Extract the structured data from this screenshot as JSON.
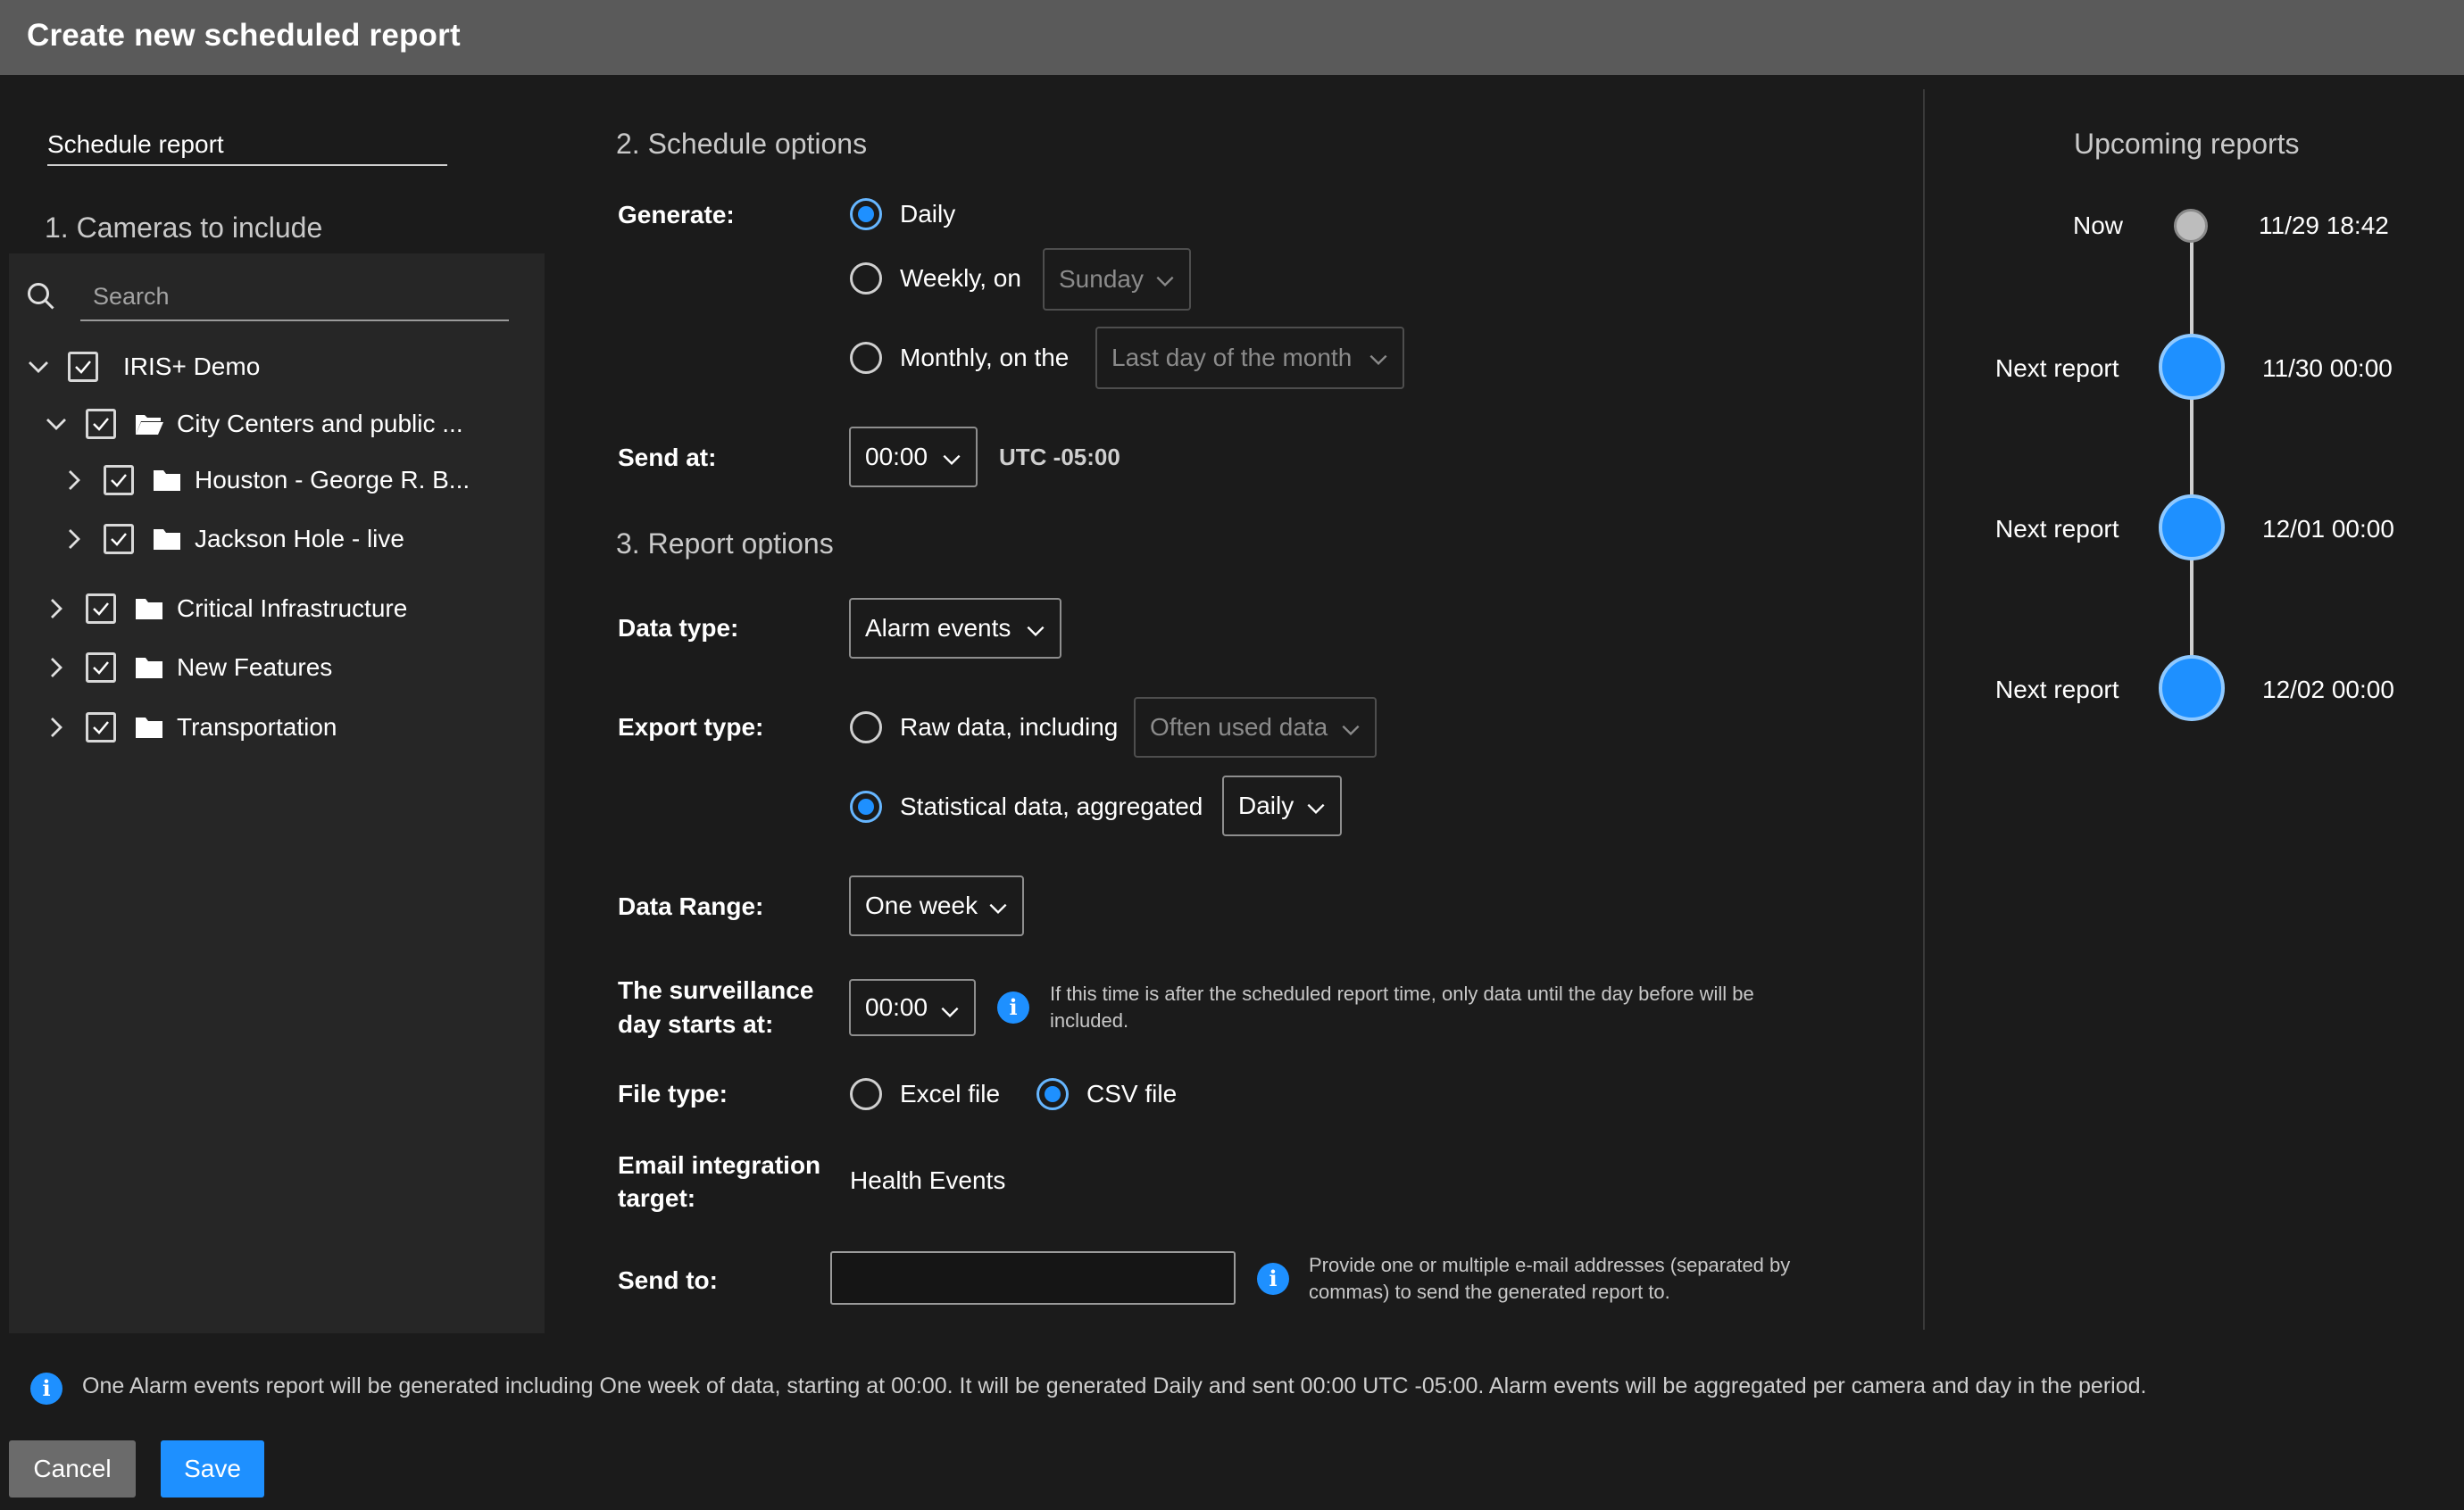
{
  "dialog": {
    "title": "Create new scheduled report"
  },
  "left": {
    "tab_label": "Schedule report",
    "section_title": "1. Cameras to include",
    "search": {
      "placeholder": "Search",
      "value": ""
    },
    "tree": [
      {
        "label": "IRIS+ Demo",
        "expanded": true,
        "checked": true,
        "icon": "none"
      },
      {
        "label": "City Centers and public ...",
        "expanded": true,
        "checked": true,
        "icon": "folder-open-icon"
      },
      {
        "label": "Houston - George R. B...",
        "expanded": false,
        "checked": true,
        "icon": "folder-icon"
      },
      {
        "label": "Jackson Hole - live",
        "expanded": false,
        "checked": true,
        "icon": "folder-icon"
      },
      {
        "label": "Critical Infrastructure",
        "expanded": false,
        "checked": true,
        "icon": "folder-icon"
      },
      {
        "label": "New Features",
        "expanded": false,
        "checked": true,
        "icon": "folder-icon"
      },
      {
        "label": "Transportation",
        "expanded": false,
        "checked": true,
        "icon": "folder-icon"
      }
    ]
  },
  "schedule": {
    "section_title": "2. Schedule options",
    "generate_label": "Generate:",
    "daily_label": "Daily",
    "weekly_label": "Weekly, on",
    "weekly_day": "Sunday",
    "monthly_label": "Monthly, on the",
    "monthly_value": "Last day of the month",
    "send_at_label": "Send at:",
    "send_at_value": "00:00",
    "timezone": "UTC -05:00"
  },
  "report": {
    "section_title": "3. Report options",
    "data_type_label": "Data type:",
    "data_type_value": "Alarm events",
    "export_type_label": "Export type:",
    "raw_label": "Raw data, including",
    "raw_value": "Often used data",
    "stat_label": "Statistical data, aggregated",
    "stat_value": "Daily",
    "data_range_label": "Data Range:",
    "data_range_value": "One week",
    "day_start_label_1": "The surveillance",
    "day_start_label_2": "day starts at:",
    "day_start_value": "00:00",
    "day_start_note_1": "If this time is after the scheduled report time, only data until the day before will be",
    "day_start_note_2": "included.",
    "file_type_label": "File type:",
    "excel_label": "Excel file",
    "csv_label": "CSV file",
    "email_label_1": "Email integration",
    "email_label_2": "target:",
    "email_value": "Health Events",
    "send_to_label": "Send to:",
    "send_to_value": "",
    "send_to_note_1": "Provide one or multiple e-mail addresses (separated by",
    "send_to_note_2": "commas) to send the generated report to."
  },
  "upcoming": {
    "title": "Upcoming reports",
    "now_label": "Now",
    "now_time": "11/29 18:42",
    "items": [
      {
        "label": "Next report",
        "time": "11/30 00:00"
      },
      {
        "label": "Next report",
        "time": "12/01 00:00"
      },
      {
        "label": "Next report",
        "time": "12/02 00:00"
      }
    ]
  },
  "footer": {
    "summary": "One Alarm events report will be generated including One week of data, starting at 00:00. It will be generated Daily and sent 00:00 UTC -05:00. Alarm events will be aggregated per camera and day in the period.",
    "cancel_label": "Cancel",
    "save_label": "Save"
  },
  "colors": {
    "accent": "#1e90ff",
    "header_bg": "#5a5a5a",
    "page_bg": "#1b1b1b",
    "panel_bg": "#262626"
  }
}
